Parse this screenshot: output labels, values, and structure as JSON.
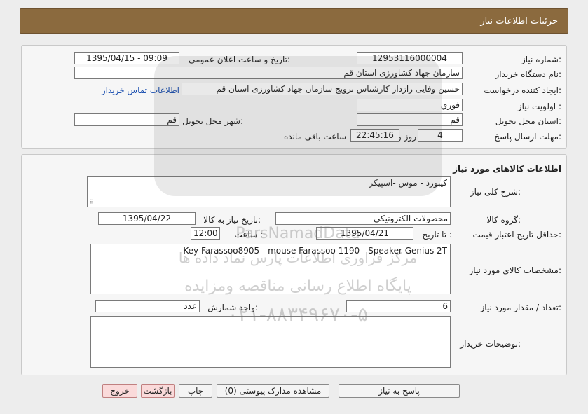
{
  "header": {
    "title": "جزئیات اطلاعات نیاز"
  },
  "info": {
    "need_number_label": "شماره نیاز:",
    "need_number": "12953116000004",
    "announce_label": "تاریخ و ساعت اعلان عمومی:",
    "announce_value": "1395/04/15 - 09:09",
    "buyer_org_label": "نام دستگاه خریدار:",
    "buyer_org": "سازمان جهاد کشاورزی استان قم",
    "requester_label": "ایجاد کننده درخواست:",
    "requester": "حسین وفایی رازدار کارشناس ترویج سازمان جهاد کشاورزی استان قم",
    "contact_link": "اطلاعات تماس خریدار",
    "priority_label": "اولویت نیاز :",
    "priority": "فوري",
    "province_label": "استان محل تحویل:",
    "province": "قم",
    "city_label": "شهر محل تحویل:",
    "city": "قم",
    "deadline_label": "مهلت ارسال پاسخ:",
    "days": "4",
    "days_label": "روز و",
    "time_left": "22:45:16",
    "time_left_label": "ساعت باقی مانده"
  },
  "goods": {
    "section_title": "اطلاعات کالاهای مورد نیاز",
    "summary_label": "شرح کلی نیاز:",
    "summary": "کیبورد - موس -اسپیکر",
    "group_label": "گروه کالا:",
    "group": "محصولات الکترونیکی",
    "need_date_label": "تاریخ نیاز به کالا:",
    "need_date": "1395/04/22",
    "min_price_label": "حداقل تاریخ اعتبار قیمت:",
    "until_date_label": "تا تاریخ :",
    "until_date": "1395/04/21",
    "time_label": "ساعت :",
    "time": "12:00",
    "specs_label": "مشخصات کالای مورد نیاز:",
    "specs": "Key Farassoo8905 - mouse Farassoo 1190 - Speaker Genius 2T",
    "qty_label": "تعداد / مقدار مورد نیاز:",
    "qty": "6",
    "unit_label": "واحد شمارش:",
    "unit": "عدد",
    "buyer_notes_label": "توضیحات خریدار:",
    "buyer_notes": ""
  },
  "buttons": {
    "reply": "پاسخ به نیاز",
    "docs": "مشاهده مدارک پیوستی (0)",
    "print": "چاپ",
    "back": "بازگشت",
    "exit": "خروج"
  },
  "watermark": {
    "line1": "مرکز فراوری اطلاعات پارس نماد داده ها",
    "line2": "پایگاه اطلاع رسانی مناقصه ومزایده",
    "phone": "۰۲۱-۸۸۳۴۹۶۷۰-۵",
    "brand": "ParsNamadData"
  },
  "colors": {
    "header_bg": "#8b6a3e",
    "link": "#1a4fb0",
    "exit_bg": "#fadada"
  }
}
